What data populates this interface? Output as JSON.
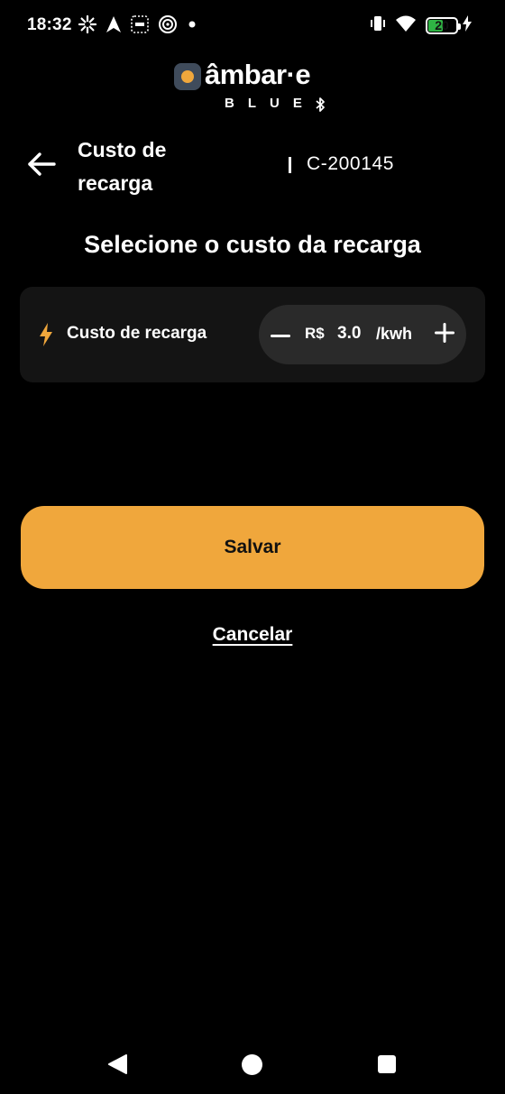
{
  "status_bar": {
    "time": "18:32",
    "battery_level": "20",
    "battery_percent": 20,
    "battery_color": "#2fb344",
    "icons_left": [
      "pinwheel-icon",
      "navigation-arrow-icon",
      "vpn-box-icon",
      "spiral-icon",
      "dot-icon"
    ],
    "icons_right": [
      "vibrate-icon",
      "wifi-icon",
      "battery-icon",
      "charging-bolt-icon"
    ]
  },
  "logo": {
    "word": "âmbar·e",
    "sub": "BLUE",
    "mark_icon": "amber-drop-icon",
    "sub_icon": "bluetooth-icon"
  },
  "header": {
    "title": "Custo de recarga",
    "device_id": "C-200145",
    "back_icon": "arrow-left-icon"
  },
  "main": {
    "heading": "Selecione o custo da recarga",
    "cost": {
      "label": "Custo de recarga",
      "icon": "lightning-bolt-icon",
      "currency": "R$",
      "value": "3.0",
      "unit": "/kwh",
      "minus_icon": "minus-icon",
      "plus_icon": "plus-icon"
    }
  },
  "actions": {
    "save_label": "Salvar",
    "cancel_label": "Cancelar"
  },
  "nav_bar": {
    "icons": [
      "nav-back-icon",
      "nav-home-icon",
      "nav-recents-icon"
    ]
  },
  "colors": {
    "background": "#000000",
    "accent": "#f0a73c",
    "card": "#141414",
    "stepper": "#2a2a2a",
    "logo_mark": "#3f4b5b"
  }
}
